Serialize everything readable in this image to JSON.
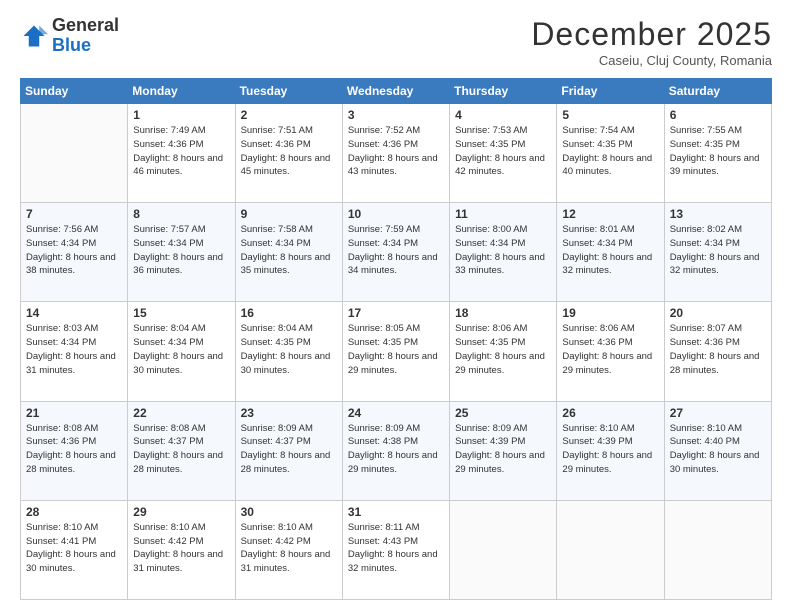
{
  "logo": {
    "general": "General",
    "blue": "Blue"
  },
  "header": {
    "month": "December 2025",
    "location": "Caseiu, Cluj County, Romania"
  },
  "weekdays": [
    "Sunday",
    "Monday",
    "Tuesday",
    "Wednesday",
    "Thursday",
    "Friday",
    "Saturday"
  ],
  "weeks": [
    [
      {
        "day": "",
        "sunrise": "",
        "sunset": "",
        "daylight": ""
      },
      {
        "day": "1",
        "sunrise": "Sunrise: 7:49 AM",
        "sunset": "Sunset: 4:36 PM",
        "daylight": "Daylight: 8 hours and 46 minutes."
      },
      {
        "day": "2",
        "sunrise": "Sunrise: 7:51 AM",
        "sunset": "Sunset: 4:36 PM",
        "daylight": "Daylight: 8 hours and 45 minutes."
      },
      {
        "day": "3",
        "sunrise": "Sunrise: 7:52 AM",
        "sunset": "Sunset: 4:36 PM",
        "daylight": "Daylight: 8 hours and 43 minutes."
      },
      {
        "day": "4",
        "sunrise": "Sunrise: 7:53 AM",
        "sunset": "Sunset: 4:35 PM",
        "daylight": "Daylight: 8 hours and 42 minutes."
      },
      {
        "day": "5",
        "sunrise": "Sunrise: 7:54 AM",
        "sunset": "Sunset: 4:35 PM",
        "daylight": "Daylight: 8 hours and 40 minutes."
      },
      {
        "day": "6",
        "sunrise": "Sunrise: 7:55 AM",
        "sunset": "Sunset: 4:35 PM",
        "daylight": "Daylight: 8 hours and 39 minutes."
      }
    ],
    [
      {
        "day": "7",
        "sunrise": "Sunrise: 7:56 AM",
        "sunset": "Sunset: 4:34 PM",
        "daylight": "Daylight: 8 hours and 38 minutes."
      },
      {
        "day": "8",
        "sunrise": "Sunrise: 7:57 AM",
        "sunset": "Sunset: 4:34 PM",
        "daylight": "Daylight: 8 hours and 36 minutes."
      },
      {
        "day": "9",
        "sunrise": "Sunrise: 7:58 AM",
        "sunset": "Sunset: 4:34 PM",
        "daylight": "Daylight: 8 hours and 35 minutes."
      },
      {
        "day": "10",
        "sunrise": "Sunrise: 7:59 AM",
        "sunset": "Sunset: 4:34 PM",
        "daylight": "Daylight: 8 hours and 34 minutes."
      },
      {
        "day": "11",
        "sunrise": "Sunrise: 8:00 AM",
        "sunset": "Sunset: 4:34 PM",
        "daylight": "Daylight: 8 hours and 33 minutes."
      },
      {
        "day": "12",
        "sunrise": "Sunrise: 8:01 AM",
        "sunset": "Sunset: 4:34 PM",
        "daylight": "Daylight: 8 hours and 32 minutes."
      },
      {
        "day": "13",
        "sunrise": "Sunrise: 8:02 AM",
        "sunset": "Sunset: 4:34 PM",
        "daylight": "Daylight: 8 hours and 32 minutes."
      }
    ],
    [
      {
        "day": "14",
        "sunrise": "Sunrise: 8:03 AM",
        "sunset": "Sunset: 4:34 PM",
        "daylight": "Daylight: 8 hours and 31 minutes."
      },
      {
        "day": "15",
        "sunrise": "Sunrise: 8:04 AM",
        "sunset": "Sunset: 4:34 PM",
        "daylight": "Daylight: 8 hours and 30 minutes."
      },
      {
        "day": "16",
        "sunrise": "Sunrise: 8:04 AM",
        "sunset": "Sunset: 4:35 PM",
        "daylight": "Daylight: 8 hours and 30 minutes."
      },
      {
        "day": "17",
        "sunrise": "Sunrise: 8:05 AM",
        "sunset": "Sunset: 4:35 PM",
        "daylight": "Daylight: 8 hours and 29 minutes."
      },
      {
        "day": "18",
        "sunrise": "Sunrise: 8:06 AM",
        "sunset": "Sunset: 4:35 PM",
        "daylight": "Daylight: 8 hours and 29 minutes."
      },
      {
        "day": "19",
        "sunrise": "Sunrise: 8:06 AM",
        "sunset": "Sunset: 4:36 PM",
        "daylight": "Daylight: 8 hours and 29 minutes."
      },
      {
        "day": "20",
        "sunrise": "Sunrise: 8:07 AM",
        "sunset": "Sunset: 4:36 PM",
        "daylight": "Daylight: 8 hours and 28 minutes."
      }
    ],
    [
      {
        "day": "21",
        "sunrise": "Sunrise: 8:08 AM",
        "sunset": "Sunset: 4:36 PM",
        "daylight": "Daylight: 8 hours and 28 minutes."
      },
      {
        "day": "22",
        "sunrise": "Sunrise: 8:08 AM",
        "sunset": "Sunset: 4:37 PM",
        "daylight": "Daylight: 8 hours and 28 minutes."
      },
      {
        "day": "23",
        "sunrise": "Sunrise: 8:09 AM",
        "sunset": "Sunset: 4:37 PM",
        "daylight": "Daylight: 8 hours and 28 minutes."
      },
      {
        "day": "24",
        "sunrise": "Sunrise: 8:09 AM",
        "sunset": "Sunset: 4:38 PM",
        "daylight": "Daylight: 8 hours and 29 minutes."
      },
      {
        "day": "25",
        "sunrise": "Sunrise: 8:09 AM",
        "sunset": "Sunset: 4:39 PM",
        "daylight": "Daylight: 8 hours and 29 minutes."
      },
      {
        "day": "26",
        "sunrise": "Sunrise: 8:10 AM",
        "sunset": "Sunset: 4:39 PM",
        "daylight": "Daylight: 8 hours and 29 minutes."
      },
      {
        "day": "27",
        "sunrise": "Sunrise: 8:10 AM",
        "sunset": "Sunset: 4:40 PM",
        "daylight": "Daylight: 8 hours and 30 minutes."
      }
    ],
    [
      {
        "day": "28",
        "sunrise": "Sunrise: 8:10 AM",
        "sunset": "Sunset: 4:41 PM",
        "daylight": "Daylight: 8 hours and 30 minutes."
      },
      {
        "day": "29",
        "sunrise": "Sunrise: 8:10 AM",
        "sunset": "Sunset: 4:42 PM",
        "daylight": "Daylight: 8 hours and 31 minutes."
      },
      {
        "day": "30",
        "sunrise": "Sunrise: 8:10 AM",
        "sunset": "Sunset: 4:42 PM",
        "daylight": "Daylight: 8 hours and 31 minutes."
      },
      {
        "day": "31",
        "sunrise": "Sunrise: 8:11 AM",
        "sunset": "Sunset: 4:43 PM",
        "daylight": "Daylight: 8 hours and 32 minutes."
      },
      {
        "day": "",
        "sunrise": "",
        "sunset": "",
        "daylight": ""
      },
      {
        "day": "",
        "sunrise": "",
        "sunset": "",
        "daylight": ""
      },
      {
        "day": "",
        "sunrise": "",
        "sunset": "",
        "daylight": ""
      }
    ]
  ]
}
